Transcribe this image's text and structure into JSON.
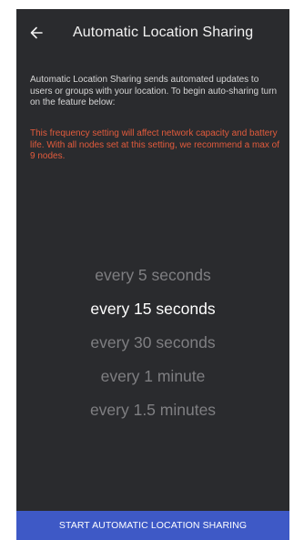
{
  "colors": {
    "background": "#2a2b2e",
    "title_text": "#f2f2f2",
    "body_text": "#d6d6d6",
    "warning_text": "#e25b3c",
    "picker_inactive": "#7f7f82",
    "picker_selected": "#ffffff",
    "button_background": "#3e59c6",
    "button_text": "#ffffff"
  },
  "app_bar": {
    "back_icon": "arrow-left-icon",
    "title": "Automatic Location Sharing"
  },
  "content": {
    "intro": "Automatic Location Sharing sends automated updates to users or groups with your location. To begin auto-sharing turn on the feature below:",
    "warning": "This frequency setting will affect network capacity and battery life. With all nodes set at this setting, we recommend a max of 9 nodes."
  },
  "picker": {
    "selected": "every 15 seconds",
    "options": [
      "every 5 seconds",
      "every 15 seconds",
      "every 30 seconds",
      "every 1 minute",
      "every 1.5 minutes"
    ]
  },
  "footer": {
    "start_label": "START AUTOMATIC LOCATION SHARING"
  }
}
